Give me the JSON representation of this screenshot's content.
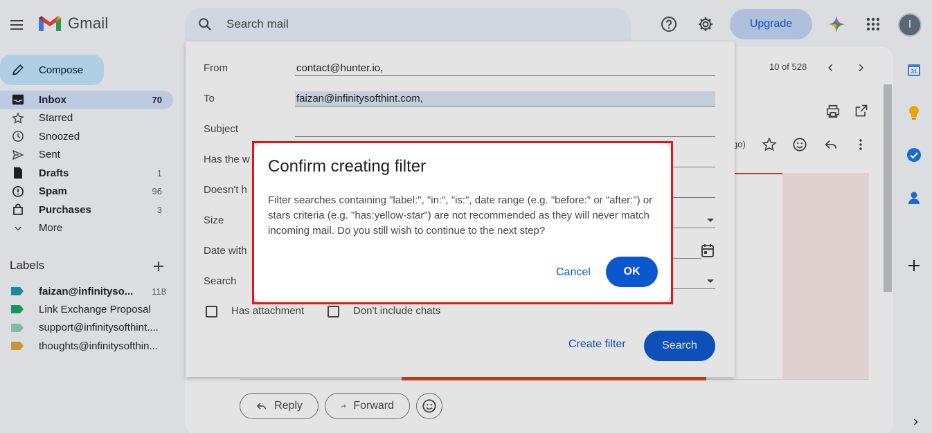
{
  "app": {
    "name": "Gmail"
  },
  "search": {
    "placeholder": "Search mail"
  },
  "top": {
    "upgrade_label": "Upgrade",
    "avatar_initial": "I"
  },
  "sidebar": {
    "compose_label": "Compose",
    "items": [
      {
        "label": "Inbox",
        "count": "70"
      },
      {
        "label": "Starred",
        "count": ""
      },
      {
        "label": "Snoozed",
        "count": ""
      },
      {
        "label": "Sent",
        "count": ""
      },
      {
        "label": "Drafts",
        "count": "1"
      },
      {
        "label": "Spam",
        "count": "96"
      },
      {
        "label": "Purchases",
        "count": "3"
      },
      {
        "label": "More",
        "count": ""
      }
    ],
    "labels_heading": "Labels",
    "labels": [
      {
        "label": "faizan@infinityso...",
        "count": "118",
        "color": "#1a9aa8"
      },
      {
        "label": "Link Exchange Proposal",
        "count": "",
        "color": "#16a765"
      },
      {
        "label": "support@infinitysofthint....",
        "count": "",
        "color": "#8fd1b3"
      },
      {
        "label": "thoughts@infinitysofthin...",
        "count": "",
        "color": "#e8a23a"
      }
    ]
  },
  "mail": {
    "pager": "10 of 528",
    "time_fragment": "go)",
    "reply_label": "Reply",
    "forward_label": "Forward"
  },
  "search_panel": {
    "from_label": "From",
    "from_value": "contact@hunter.io,",
    "to_label": "To",
    "to_value": "faizan@infinitysofthint.com,",
    "subject_label": "Subject",
    "has_words_label": "Has the w",
    "doesnt_have_label": "Doesn't h",
    "size_label": "Size",
    "date_within_label": "Date with",
    "search_label": "Search",
    "has_attachment_label": "Has attachment",
    "dont_include_chats_label": "Don't include chats",
    "create_filter_label": "Create filter",
    "search_button_label": "Search"
  },
  "modal": {
    "title": "Confirm creating filter",
    "body": "Filter searches containing \"label:\", \"in:\", \"is:\", date range (e.g. \"before:\" or \"after:\") or stars criteria (e.g. \"has:yellow-star\") are not recommended as they will never match incoming mail. Do you still wish to continue to the next step?",
    "cancel_label": "Cancel",
    "ok_label": "OK"
  },
  "colors": {
    "accent": "#0b57d0",
    "highlight_outline": "#e0161b"
  }
}
